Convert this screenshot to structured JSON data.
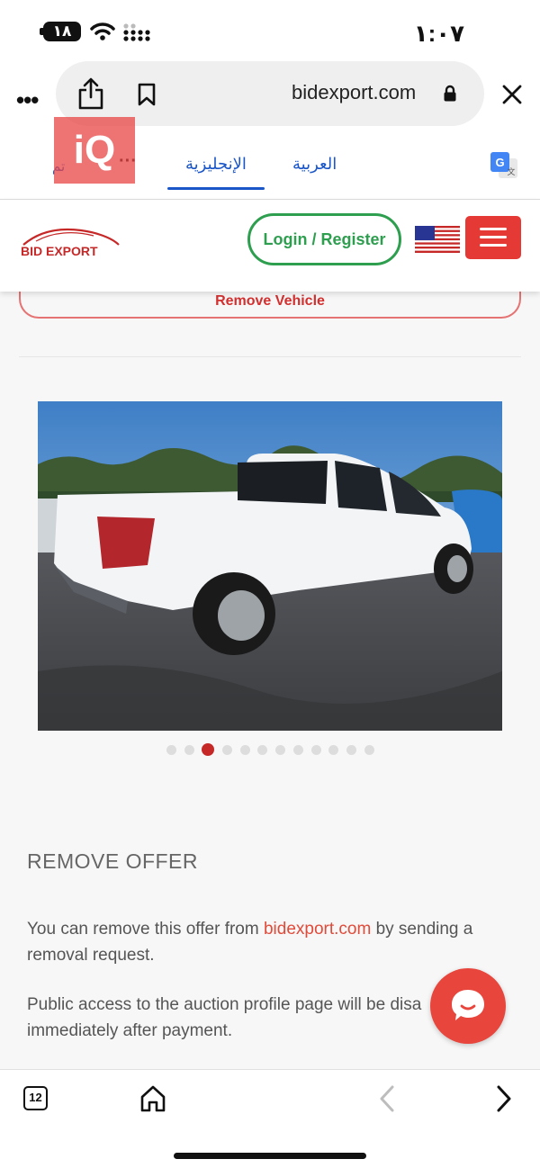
{
  "status_bar": {
    "battery": "١٨",
    "time": "١:٠٧"
  },
  "browser": {
    "url": "bidexport.com",
    "tabs_count": "12"
  },
  "translate_bar": {
    "truncated_label": "تم",
    "more": "···",
    "english_label": "الإنجليزية",
    "arabic_label": "العربية",
    "selected": "english"
  },
  "watermark": "iQ",
  "site_header": {
    "logo_text": "BID EXPORT",
    "login_label": "Login / Register",
    "flag": "US"
  },
  "content": {
    "remove_vehicle_label": "Remove Vehicle",
    "gallery": {
      "total_images": 12,
      "active_index": 3
    },
    "remove_offer_title": "REMOVE OFFER",
    "para1_before": "You can remove this offer from ",
    "para1_link": "bidexport.com",
    "para1_after": " by sending a removal request.",
    "para2": "Public access to the auction profile page will be disa",
    "para2_line2": "immediately after payment."
  },
  "colors": {
    "brand_red": "#e53935",
    "login_green": "#2e9e4f",
    "translate_blue": "#1a56c8",
    "link_red": "#e04b3a"
  }
}
